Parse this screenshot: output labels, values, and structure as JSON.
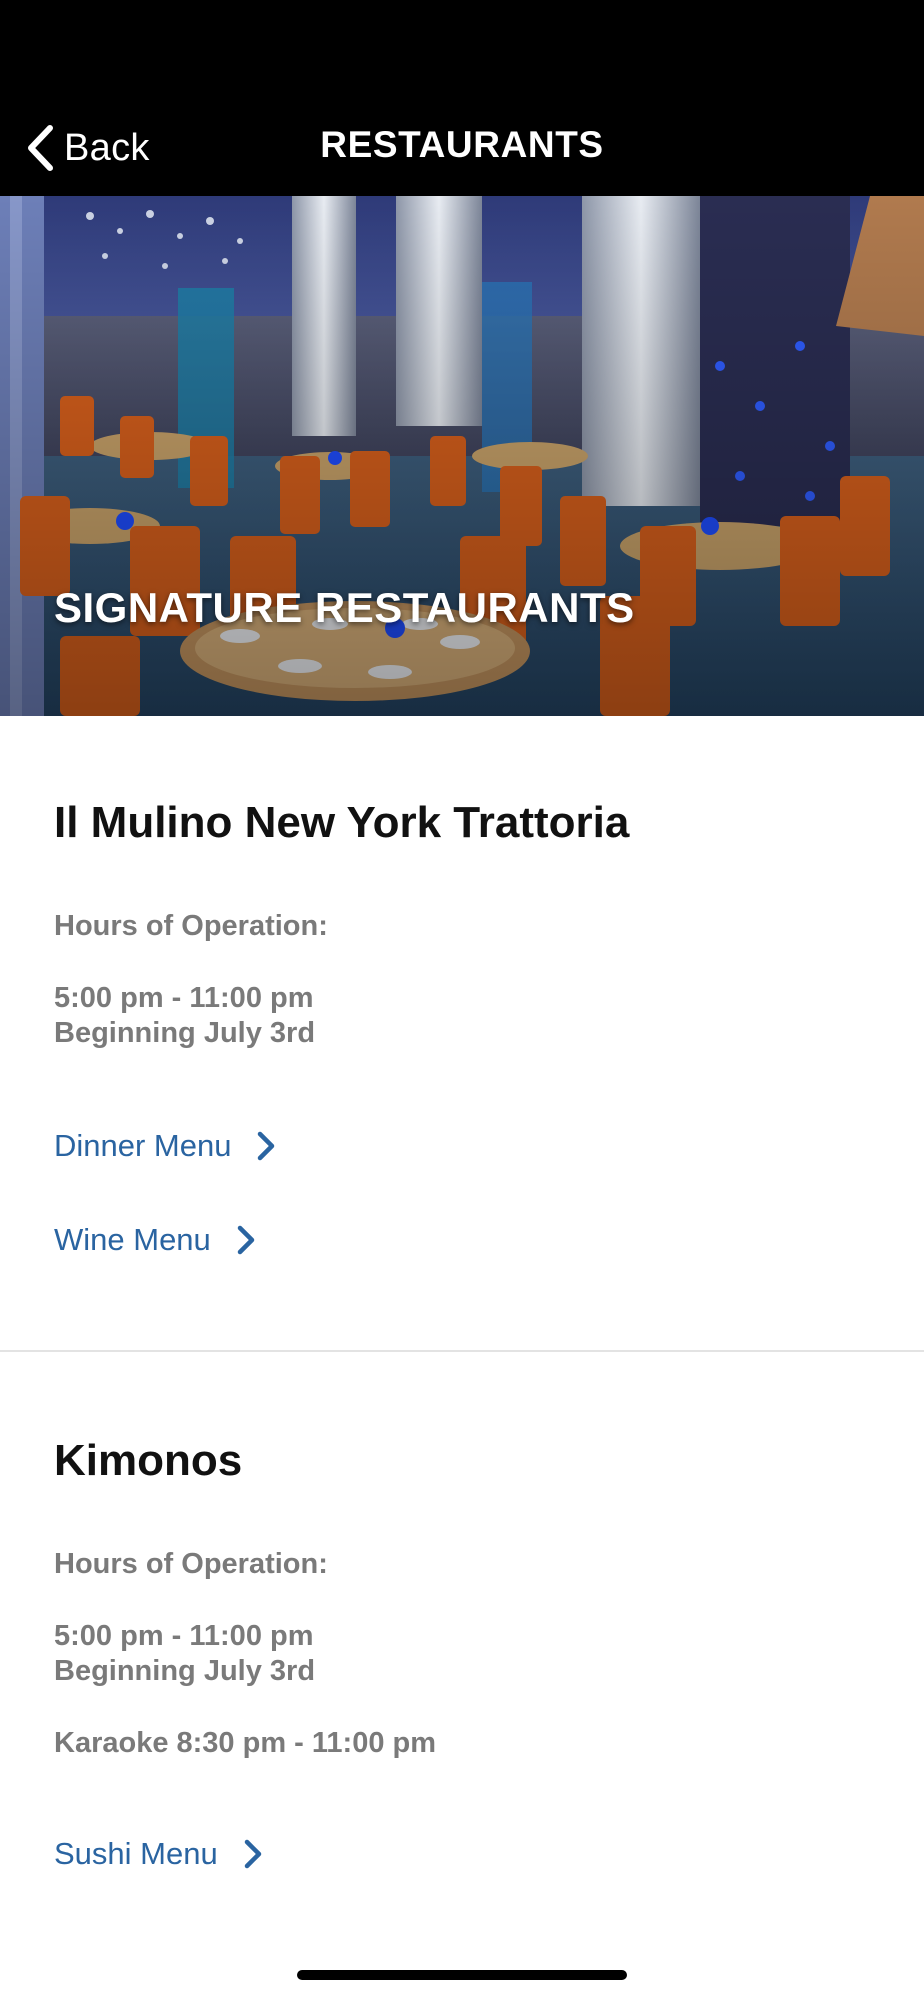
{
  "nav": {
    "back_label": "Back",
    "title": "RESTAURANTS"
  },
  "hero": {
    "title": "SIGNATURE RESTAURANTS"
  },
  "restaurants": [
    {
      "name": "Il Mulino New York Trattoria",
      "hours_heading": "Hours of Operation:",
      "hours": "5:00 pm - 11:00 pm",
      "start": "Beginning July 3rd",
      "links": [
        {
          "label": "Dinner Menu",
          "icon": "chevron-right-icon"
        },
        {
          "label": "Wine Menu",
          "icon": "chevron-right-icon"
        }
      ]
    },
    {
      "name": "Kimonos",
      "hours_heading": "Hours of Operation:",
      "hours": "5:00 pm - 11:00 pm",
      "start": "Beginning July 3rd",
      "extra": "Karaoke 8:30 pm - 11:00 pm",
      "links": [
        {
          "label": "Sushi Menu",
          "icon": "chevron-right-icon"
        }
      ]
    }
  ],
  "colors": {
    "nav_background": "#000000",
    "link": "#2a64a1",
    "secondary_text": "#7a7a7a",
    "divider": "#e3e3e3"
  }
}
